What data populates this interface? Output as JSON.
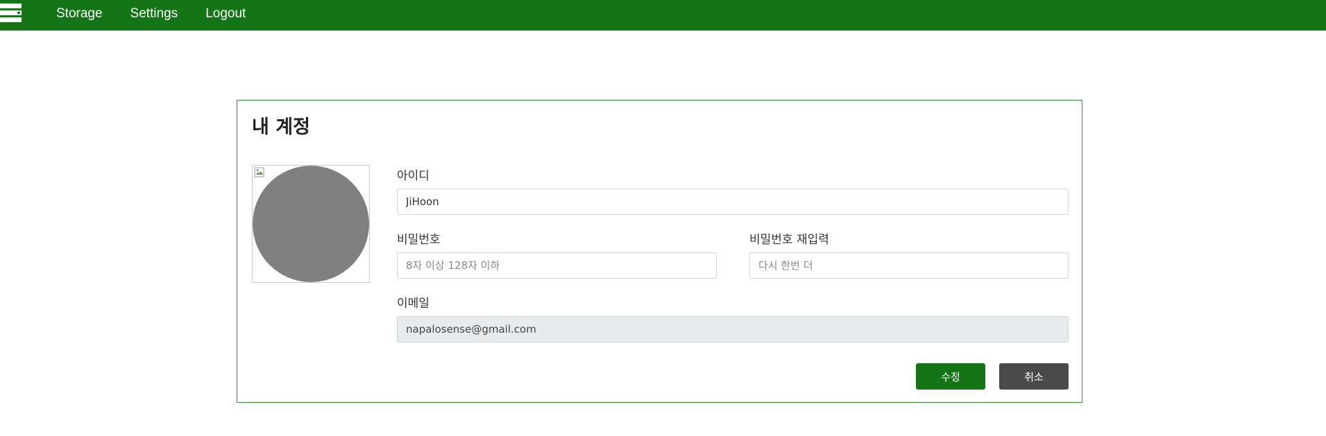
{
  "topbar": {
    "bg_color": "#147516",
    "logo_icon": "server-icon",
    "nav": [
      {
        "label": "Storage"
      },
      {
        "label": "Settings"
      },
      {
        "label": "Logout"
      }
    ]
  },
  "account": {
    "title": "내 계정",
    "avatar_icon": "avatar-placeholder-icon",
    "fields": {
      "id_label": "아이디",
      "id_value": "JiHoon",
      "password_label": "비밀번호",
      "password_placeholder": "8자 이상 128자 이하",
      "password_confirm_label": "비밀번호 재입력",
      "password_confirm_placeholder": "다시 한번 더",
      "email_label": "이메일",
      "email_value": "napalosense@gmail.com"
    },
    "buttons": {
      "save_label": "수정",
      "cancel_label": "취소"
    }
  },
  "colors": {
    "accent": "#147516",
    "secondary_button": "#4a4a4a",
    "card_border": "#2e8b2e"
  }
}
